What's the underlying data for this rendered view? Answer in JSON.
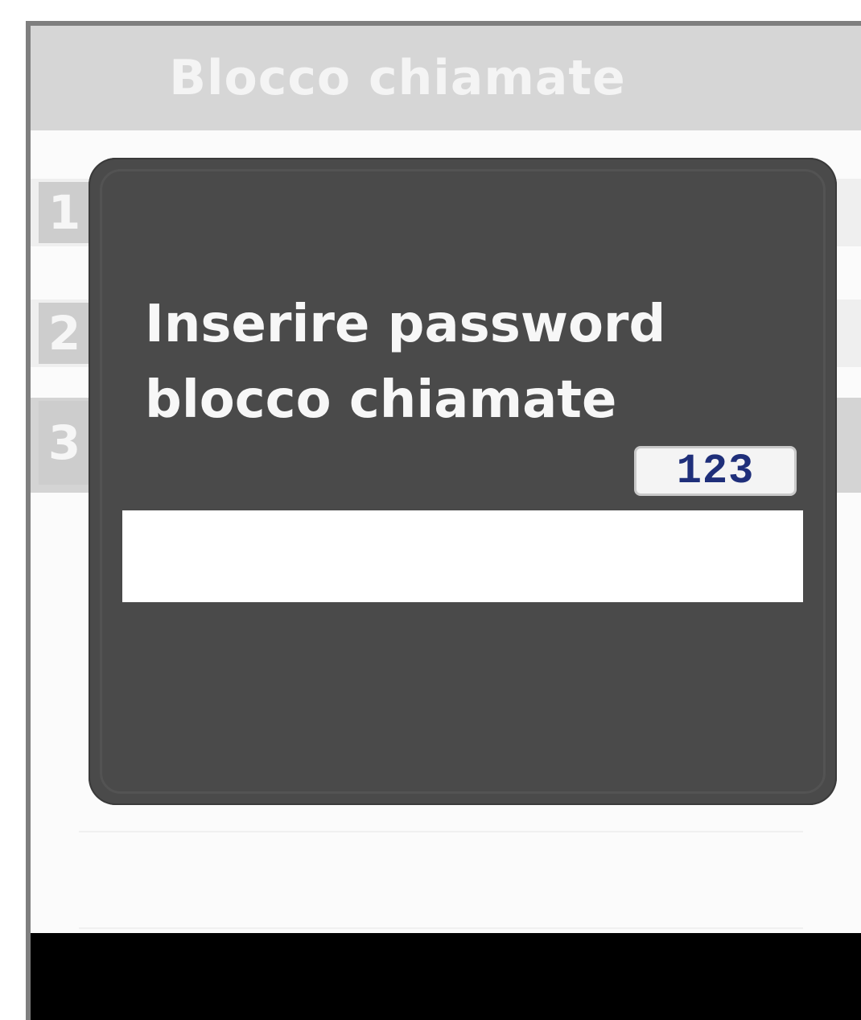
{
  "screen": {
    "title": "Blocco chiamate"
  },
  "menu": {
    "items": [
      {
        "number": "1",
        "label": ""
      },
      {
        "number": "2",
        "label": ""
      },
      {
        "number": "3",
        "label": "",
        "selected": true
      }
    ]
  },
  "dialog": {
    "prompt_line_1": "Inserire password",
    "prompt_line_2": "blocco chiamate",
    "input_mode": "123",
    "password_value": ""
  },
  "colors": {
    "title_bar": "#d6d6d6",
    "dialog_background": "#4a4a4a",
    "input_mode_text": "#1f2f7a",
    "softkey_bar": "#000000"
  }
}
